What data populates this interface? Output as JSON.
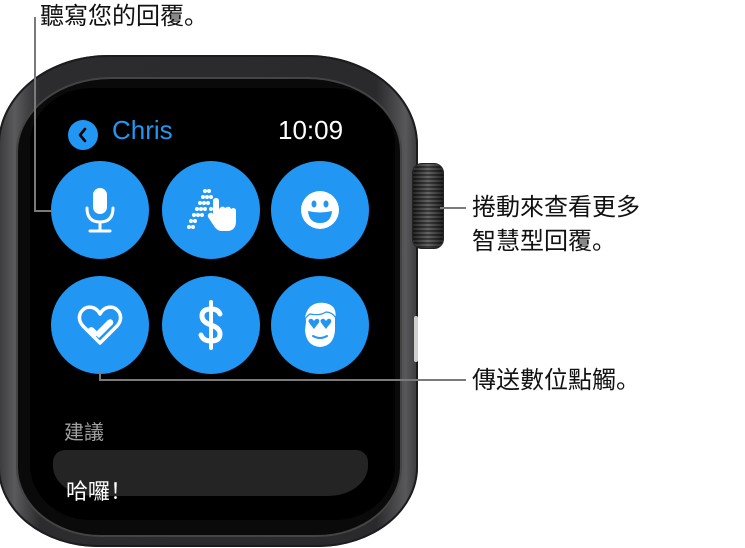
{
  "callouts": {
    "dictate": "聽寫您的回覆。",
    "scroll_line1": "捲動來查看更多",
    "scroll_line2": "智慧型回覆。",
    "digital_touch": "傳送數位點觸。"
  },
  "watch": {
    "header": {
      "back_icon": "chevron-left-icon",
      "contact_name": "Chris",
      "time": "10:09"
    },
    "reply_buttons": [
      {
        "id": "dictation",
        "icon": "microphone-icon"
      },
      {
        "id": "scribble",
        "icon": "scribble-hand-icon"
      },
      {
        "id": "emoji",
        "icon": "smiley-icon"
      },
      {
        "id": "digital-touch",
        "icon": "heart-touch-icon"
      },
      {
        "id": "apple-pay",
        "icon": "dollar-icon"
      },
      {
        "id": "memoji",
        "icon": "memoji-icon"
      }
    ],
    "section_label": "建議",
    "suggestions": [
      "哈囉！"
    ]
  },
  "colors": {
    "accent": "#2196f3",
    "screen": "#000000",
    "suggestion_bg": "#242424"
  }
}
